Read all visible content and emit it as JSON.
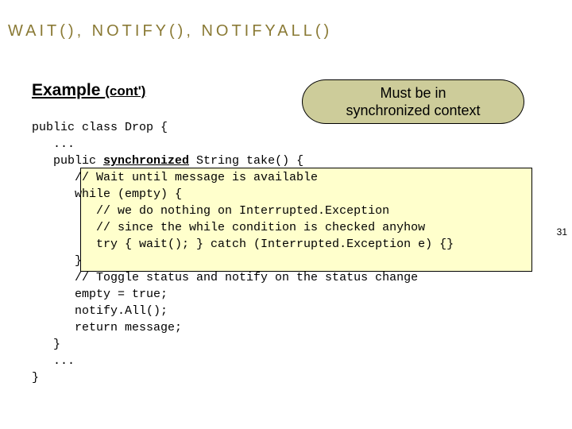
{
  "title": "WAIT(), NOTIFY(), NOTIFYALL()",
  "subtitle_main": "Example ",
  "subtitle_paren": "(cont')",
  "bubble_line1": "Must be in",
  "bubble_line2": "synchronized context",
  "page_number": "31",
  "code": {
    "l01": "public class Drop {",
    "l02": "   ...",
    "l03_a": "   public ",
    "l03_kw": "synchronized",
    "l03_b": " String take() {",
    "l04": "      // Wait until message is available",
    "l05": "      while (empty) {",
    "l06": "         // we do nothing on Interrupted.Exception",
    "l07": "         // since the while condition is checked anyhow",
    "l08": "         try { wait(); } catch (Interrupted.Exception e) {}",
    "l09": "      }",
    "l10": "      // Toggle status and notify on the status change",
    "l11": "      empty = true;",
    "l12": "      notify.All();",
    "l13": "      return message;",
    "l14": "   }",
    "l15": "   ...",
    "l16": "}"
  }
}
